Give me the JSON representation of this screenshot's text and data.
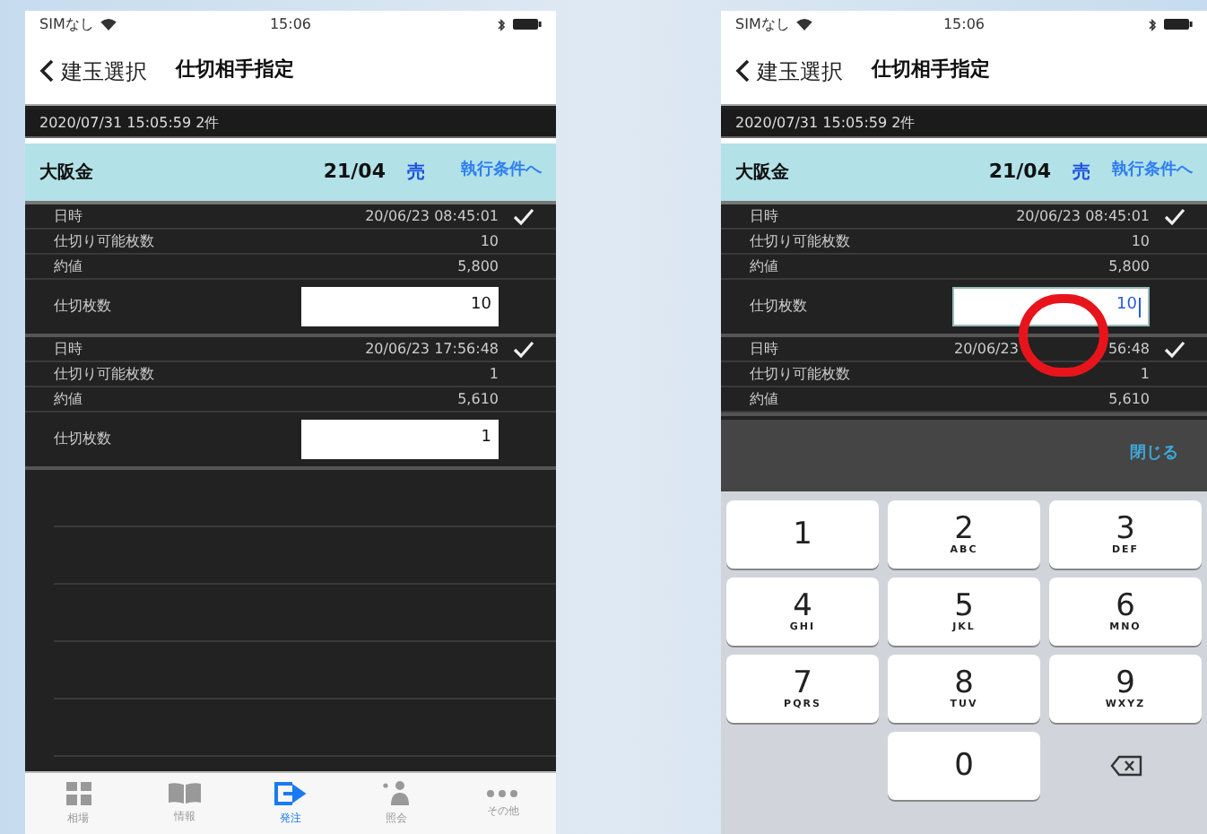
{
  "phones": [
    {
      "kind": "list",
      "status": {
        "carrier": "SIMなし",
        "time": "15:06"
      },
      "nav": {
        "back": "建玉選択",
        "title": "仕切相手指定"
      },
      "date_bar": "2020/07/31 15:05:59 2件",
      "header": {
        "name": "大阪金",
        "month": "21/04",
        "side": "売",
        "link": "執行条件へ"
      },
      "positions": [
        {
          "rows": [
            {
              "label": "日時",
              "value": "20/06/23 08:45:01"
            },
            {
              "label": "仕切り可能枚数",
              "value": "10"
            },
            {
              "label": "約値",
              "value": "5,800"
            }
          ],
          "checked": true,
          "qty_label": "仕切枚数",
          "qty": {
            "value": "10",
            "focused": false
          }
        },
        {
          "rows": [
            {
              "label": "日時",
              "value": "20/06/23 17:56:48"
            },
            {
              "label": "仕切り可能枚数",
              "value": "1"
            },
            {
              "label": "約値",
              "value": "5,610"
            }
          ],
          "checked": true,
          "qty_label": "仕切枚数",
          "qty": {
            "value": "1",
            "focused": false
          }
        }
      ],
      "tabs": [
        {
          "label": "相場",
          "selected": false
        },
        {
          "label": "情報",
          "selected": false
        },
        {
          "label": "発注",
          "selected": true
        },
        {
          "label": "照会",
          "selected": false
        },
        {
          "label": "その他",
          "selected": false
        }
      ]
    },
    {
      "kind": "keyboard",
      "status": {
        "carrier": "SIMなし",
        "time": "15:06"
      },
      "nav": {
        "back": "建玉選択",
        "title": "仕切相手指定"
      },
      "date_bar": "2020/07/31 15:05:59 2件",
      "header": {
        "name": "大阪金",
        "month": "21/04",
        "side": "売",
        "link": "執行条件へ"
      },
      "positions": [
        {
          "rows": [
            {
              "label": "日時",
              "value": "20/06/23 08:45:01"
            },
            {
              "label": "仕切り可能枚数",
              "value": "10"
            },
            {
              "label": "約値",
              "value": "5,800"
            }
          ],
          "checked": true,
          "qty_label": "仕切枚数",
          "qty": {
            "value": "10",
            "focused": true
          }
        },
        {
          "rows": [
            {
              "label": "日時",
              "value": "20/06/23",
              "value_end": "56:48"
            },
            {
              "label": "仕切り可能枚数",
              "value": "1"
            },
            {
              "label": "約値",
              "value": "5,610"
            }
          ],
          "checked": true
        }
      ],
      "done": "閉じる",
      "keys": [
        {
          "kind": "digit",
          "digit": "1"
        },
        {
          "kind": "digit",
          "digit": "2",
          "letters": "ABC"
        },
        {
          "kind": "digit",
          "digit": "3",
          "letters": "DEF"
        },
        {
          "kind": "digit",
          "digit": "4",
          "letters": "GHI"
        },
        {
          "kind": "digit",
          "digit": "5",
          "letters": "JKL"
        },
        {
          "kind": "digit",
          "digit": "6",
          "letters": "MNO"
        },
        {
          "kind": "digit",
          "digit": "7",
          "letters": "PQRS"
        },
        {
          "kind": "digit",
          "digit": "8",
          "letters": "TUV"
        },
        {
          "kind": "digit",
          "digit": "9",
          "letters": "WXYZ"
        },
        {
          "kind": "blank"
        },
        {
          "kind": "digit",
          "digit": "0"
        },
        {
          "kind": "delete"
        }
      ]
    }
  ]
}
